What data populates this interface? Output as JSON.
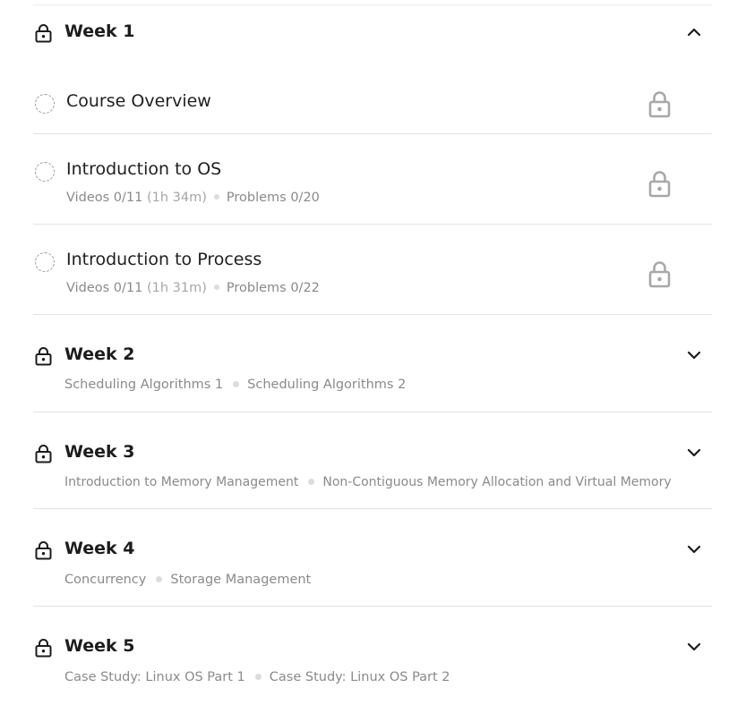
{
  "weeks": [
    {
      "title": "Week 1",
      "expanded": true,
      "topics": []
    },
    {
      "title": "Week 2",
      "expanded": false,
      "topics": [
        "Scheduling Algorithms 1",
        "Scheduling Algorithms 2"
      ]
    },
    {
      "title": "Week 3",
      "expanded": false,
      "topics": [
        "Introduction to Memory Management",
        "Non-Contiguous Memory Allocation and Virtual Memory"
      ]
    },
    {
      "title": "Week 4",
      "expanded": false,
      "topics": [
        "Concurrency",
        "Storage Management"
      ]
    },
    {
      "title": "Week 5",
      "expanded": false,
      "topics": [
        "Case Study: Linux OS Part 1",
        "Case Study: Linux OS Part 2"
      ]
    }
  ],
  "lessons": [
    {
      "title": "Course Overview",
      "videos": "",
      "duration": "",
      "problems": ""
    },
    {
      "title": "Introduction to OS",
      "videos": "Videos 0/11",
      "duration": "(1h 34m)",
      "problems": "Problems 0/20"
    },
    {
      "title": "Introduction to Process",
      "videos": "Videos 0/11",
      "duration": "(1h 31m)",
      "problems": "Problems 0/22"
    }
  ],
  "icons": {
    "week_lock": "lock-icon",
    "lesson_lock": "lock-icon",
    "expand": "chevron-down-icon",
    "collapse": "chevron-up-icon",
    "progress": "dashed-circle-icon"
  },
  "colors": {
    "text": "#1f1f1f",
    "muted": "#8a8a8a",
    "lock_gray": "#a8a8a8",
    "divider": "#e2e2e2"
  }
}
